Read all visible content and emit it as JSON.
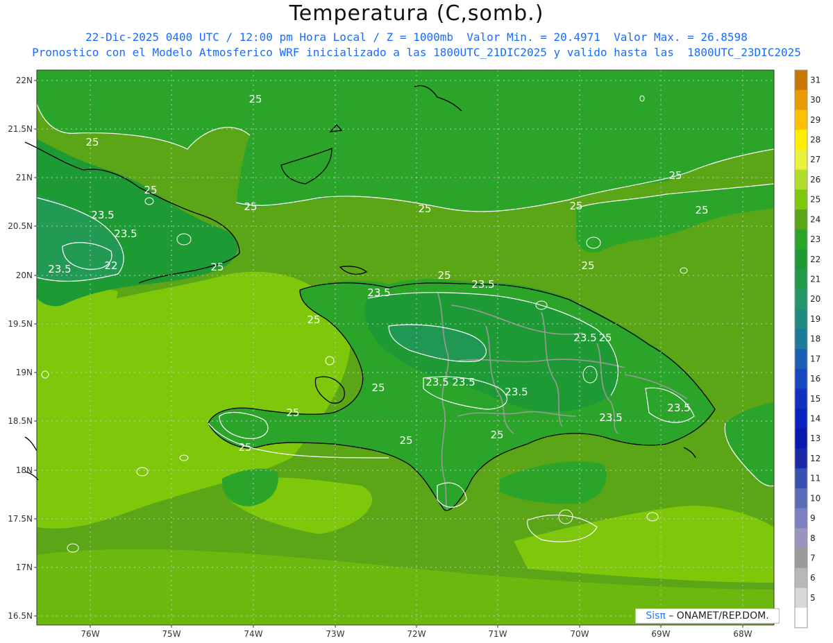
{
  "title": "Temperatura (C,somb.)",
  "subtitle_line1": "22-Dic-2025 0400 UTC / 12:00 pm Hora Local / Z = 1000mb  Valor Min. = 20.4971  Valor Max. = 26.8598",
  "subtitle_line2": "Pronostico con el Modelo Atmosferico WRF inicializado a las 1800UTC_21DIC2025 y valido hasta las  1800UTC_23DIC2025",
  "colors": {
    "ocean": "#5aa616",
    "ocean_light": "#7ec70a",
    "land_dark": "#1e9a34",
    "land_mid": "#2aa52a",
    "teal": "#289a5a",
    "coast": "#000000",
    "borders": "#999999"
  },
  "map": {
    "lat_labels": [
      "22N",
      "21.5N",
      "21N",
      "20.5N",
      "20N",
      "19.5N",
      "19N",
      "18.5N",
      "18N",
      "17.5N",
      "17N",
      "16.5N"
    ],
    "lon_labels": [
      "76W",
      "75W",
      "74W",
      "73W",
      "72W",
      "71W",
      "70W",
      "69W",
      "68W"
    ],
    "contour_labels": [
      "25",
      "25",
      "25",
      "25",
      "25",
      "25",
      "25",
      "25",
      "25",
      "25",
      "25",
      "25",
      "25",
      "25",
      "25",
      "25",
      "25",
      "25",
      "23.5",
      "23.5",
      "23.5",
      "23.5",
      "23.5",
      "23.5",
      "23.5",
      "23.5",
      "23.5",
      "23.5",
      "23.5",
      "22"
    ]
  },
  "colorbar": {
    "labels": [
      "31",
      "30",
      "29",
      "28",
      "27",
      "26",
      "25",
      "24",
      "23",
      "22",
      "21",
      "20",
      "19",
      "18",
      "17",
      "16",
      "15",
      "14",
      "13",
      "12",
      "11",
      "10",
      "9",
      "8",
      "7",
      "6",
      "5"
    ],
    "colors": [
      "#c87800",
      "#e89a00",
      "#ffc000",
      "#ffee00",
      "#e8f23a",
      "#b0de2a",
      "#7ec70a",
      "#5aa616",
      "#2aa52a",
      "#1e9a34",
      "#209a48",
      "#23966a",
      "#1f8a80",
      "#1d7a98",
      "#1a5eb6",
      "#1848c0",
      "#1030c0",
      "#0a22c0",
      "#0a18b0",
      "#1a28a8",
      "#3a50b0",
      "#5a6cb8",
      "#7a80c0",
      "#9a94c0",
      "#9a9a9a",
      "#b8b8b8",
      "#d8d8d8",
      "#ffffff"
    ]
  },
  "credit": {
    "logo": "Sisπ",
    "text": "– ONAMET/REP.DOM."
  }
}
